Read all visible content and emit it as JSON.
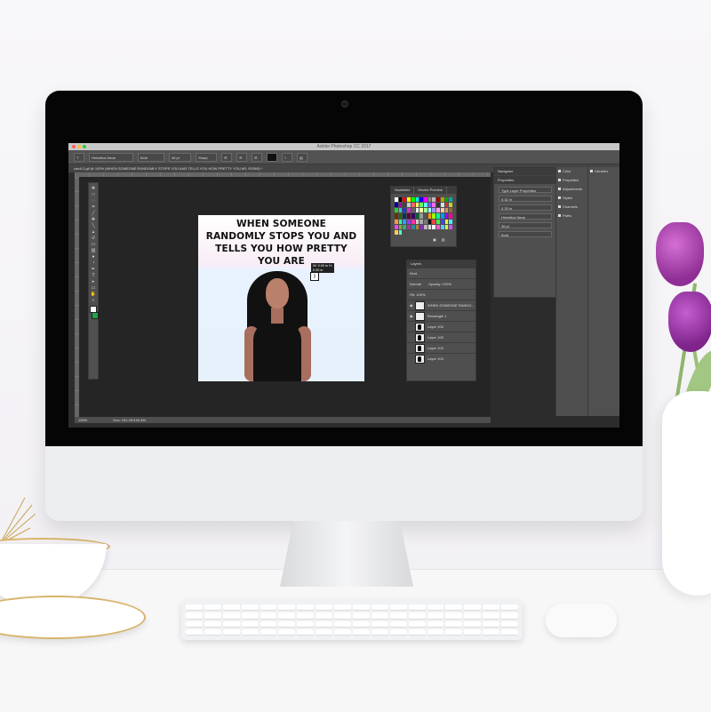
{
  "app": {
    "window_title": "Adobe Photoshop CC 2017",
    "document_tab": "cardi-2.gif @ 100% (WHEN SOMEONE RANDOMLY STOPS YOU AND TELLS YOU HOW PRETTY YOU AR, RGB/8) *",
    "zoom": "100%"
  },
  "options": {
    "tool_icon": "T",
    "font_family": "Helvetica Neue",
    "font_style": "Bold",
    "font_size": "36 pt",
    "anti_alias": "Sharp"
  },
  "canvas": {
    "headline": "WHEN SOMEONE RANDOMLY STOPS YOU AND TELLS YOU HOW PRETTY YOU ARE",
    "tooltip": "W: 0.00 in\nH: 0.00 in"
  },
  "panels": {
    "swatches_tab": "Swatches",
    "device_preview_tab": "Device Preview",
    "navigator": "Navigator",
    "properties": "Properties",
    "type_layer_properties": "Type Layer Properties",
    "layers": "Layers",
    "kind": "Kind",
    "normal": "Normal",
    "opacity": "Opacity: 100%",
    "fill": "Fill: 100%",
    "dock": [
      "Color",
      "Properties",
      "Adjustments",
      "Styles",
      "Channels",
      "Paths"
    ],
    "libraries": "Libraries"
  },
  "layers": [
    {
      "name": "WHEN SOMEONE RANDO..."
    },
    {
      "name": "Rectangle 1"
    },
    {
      "name": "Layer 106"
    },
    {
      "name": "Layer 105"
    },
    {
      "name": "Layer 104"
    },
    {
      "name": "Layer 103"
    }
  ],
  "properties_fields": [
    "0.32 in",
    "0.33 in",
    "Helvetica Neue",
    "36 pt",
    "Bold"
  ],
  "status": {
    "left": "100%",
    "doc": "Doc: 101.2K/104.4M"
  },
  "colors": {
    "ui_dark": "#2c2c2c",
    "panel": "#4f4f4f",
    "foreground": "#ffffff",
    "background_swatch": "#22a04a",
    "tulip": "#a24cb2"
  },
  "icons": {
    "tools": [
      "move-icon",
      "marquee-icon",
      "lasso-icon",
      "crop-icon",
      "eyedropper-icon",
      "heal-icon",
      "brush-icon",
      "stamp-icon",
      "history-brush-icon",
      "eraser-icon",
      "gradient-icon",
      "blur-icon",
      "dodge-icon",
      "pen-icon",
      "type-icon",
      "path-select-icon",
      "shape-icon",
      "hand-icon",
      "zoom-icon"
    ]
  }
}
